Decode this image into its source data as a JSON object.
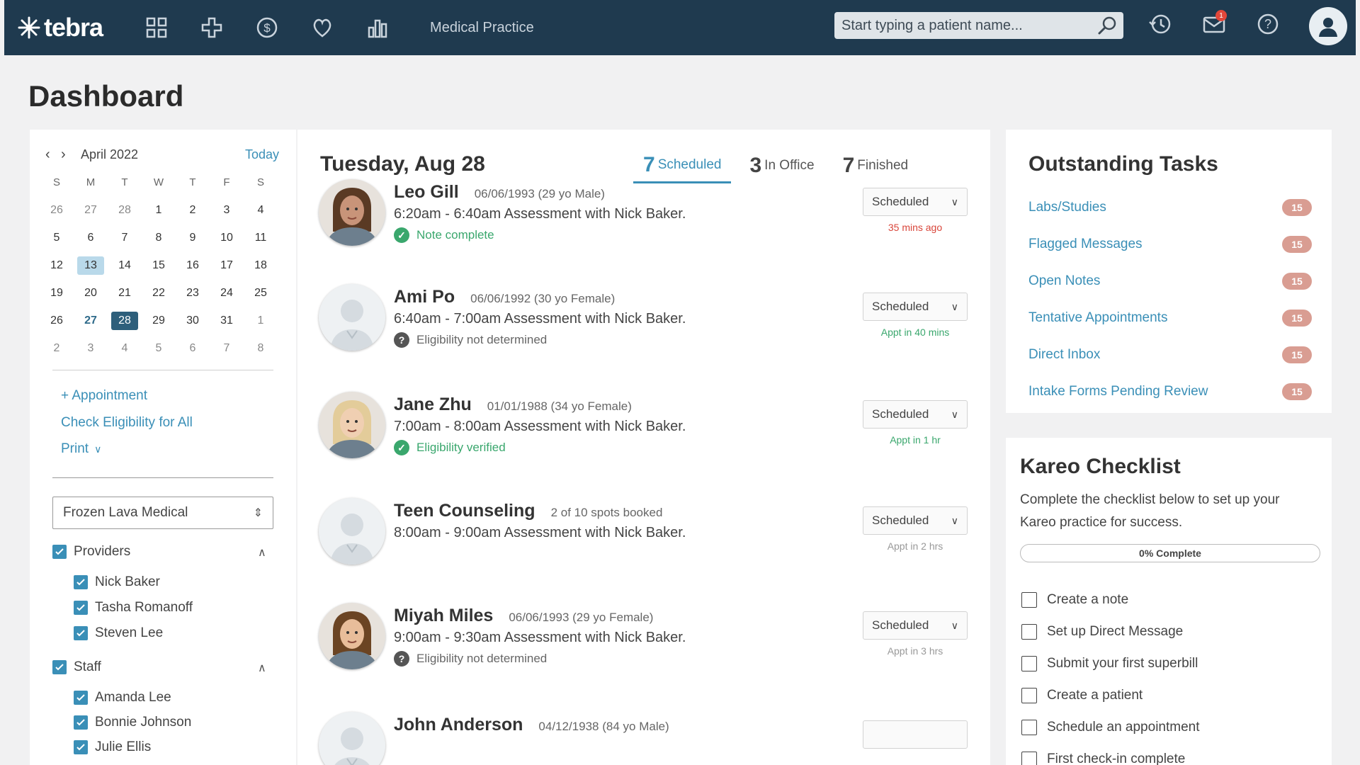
{
  "topbar": {
    "logo_text": "tebra",
    "nav_title": "Medical Practice",
    "search_placeholder": "Start typing a patient name...",
    "notification_count": "1",
    "colors": {
      "bar": "#1f3a4f",
      "accent": "#3a8fb7"
    }
  },
  "page": {
    "title": "Dashboard"
  },
  "calendar": {
    "month_label": "April 2022",
    "today_label": "Today",
    "weekdays": [
      "S",
      "M",
      "T",
      "W",
      "T",
      "F",
      "S"
    ],
    "days": [
      "26",
      "27",
      "28",
      "1",
      "2",
      "3",
      "4",
      "5",
      "6",
      "7",
      "8",
      "9",
      "10",
      "11",
      "12",
      "13",
      "14",
      "15",
      "16",
      "17",
      "18",
      "19",
      "20",
      "21",
      "22",
      "23",
      "24",
      "25",
      "26",
      "27",
      "28",
      "29",
      "30",
      "31",
      "1",
      "2",
      "3",
      "4",
      "5",
      "6",
      "7",
      "8"
    ]
  },
  "left": {
    "add_appointment": "+ Appointment",
    "check_eligibility": "Check Eligibility for All",
    "print": "Print",
    "location": "Frozen Lava Medical",
    "providers_label": "Providers",
    "providers": [
      "Nick Baker",
      "Tasha Romanoff",
      "Steven Lee"
    ],
    "staff_label": "Staff",
    "staff": [
      "Amanda Lee",
      "Bonnie Johnson",
      "Julie Ellis"
    ]
  },
  "schedule": {
    "date_title": "Tuesday, Aug 28",
    "tabs": [
      {
        "count": "7",
        "label": "Scheduled"
      },
      {
        "count": "3",
        "label": "In Office"
      },
      {
        "count": "7",
        "label": "Finished"
      }
    ],
    "appointments": [
      {
        "name": "Leo Gill",
        "dob": "06/06/1993 (29 yo Male)",
        "desc": "6:20am - 6:40am Assessment with Nick Baker.",
        "status": "Note complete",
        "status_type": "ok",
        "button": "Scheduled",
        "when": "35 mins ago",
        "when_color": "#d9463b"
      },
      {
        "name": "Ami Po",
        "dob": "06/06/1992 (30 yo Female)",
        "desc": "6:40am - 7:00am Assessment with Nick Baker.",
        "status": "Eligibility not determined",
        "status_type": "unk",
        "button": "Scheduled",
        "when": "Appt in 40 mins",
        "when_color": "#3aa76d"
      },
      {
        "name": "Jane Zhu",
        "dob": "01/01/1988 (34 yo Female)",
        "desc": "7:00am - 8:00am Assessment with Nick Baker.",
        "status": "Eligibility verified",
        "status_type": "ok",
        "button": "Scheduled",
        "when": "Appt in 1 hr",
        "when_color": "#3aa76d"
      },
      {
        "name": "Teen Counseling",
        "dob": "2 of 10 spots booked",
        "desc": "8:00am - 9:00am Assessment with Nick Baker.",
        "status": "",
        "status_type": "none",
        "button": "Scheduled",
        "when": "Appt in 2 hrs",
        "when_color": "#999999"
      },
      {
        "name": "Miyah Miles",
        "dob": "06/06/1993 (29 yo Female)",
        "desc": "9:00am - 9:30am Assessment with Nick Baker.",
        "status": "Eligibility not determined",
        "status_type": "unk",
        "button": "Scheduled",
        "when": "Appt in 3 hrs",
        "when_color": "#999999"
      },
      {
        "name": "John Anderson",
        "dob": "04/12/1938 (84 yo Male)",
        "desc": "",
        "status": "",
        "status_type": "none",
        "button": "",
        "when": "",
        "when_color": "#999999"
      }
    ]
  },
  "tasks": {
    "title": "Outstanding Tasks",
    "items": [
      {
        "label": "Labs/Studies",
        "count": "15"
      },
      {
        "label": "Flagged Messages",
        "count": "15"
      },
      {
        "label": "Open Notes",
        "count": "15"
      },
      {
        "label": "Tentative Appointments",
        "count": "15"
      },
      {
        "label": "Direct Inbox",
        "count": "15"
      },
      {
        "label": "Intake Forms Pending Review",
        "count": "15"
      }
    ]
  },
  "checklist": {
    "title": "Kareo Checklist",
    "description": "Complete the checklist below to set up your Kareo practice for success.",
    "progress_label": "0% Complete",
    "progress_value": 0,
    "items": [
      "Create a note",
      "Set up Direct Message",
      "Submit your first superbill",
      "Create a patient",
      "Schedule an appointment",
      "First check-in complete"
    ]
  }
}
